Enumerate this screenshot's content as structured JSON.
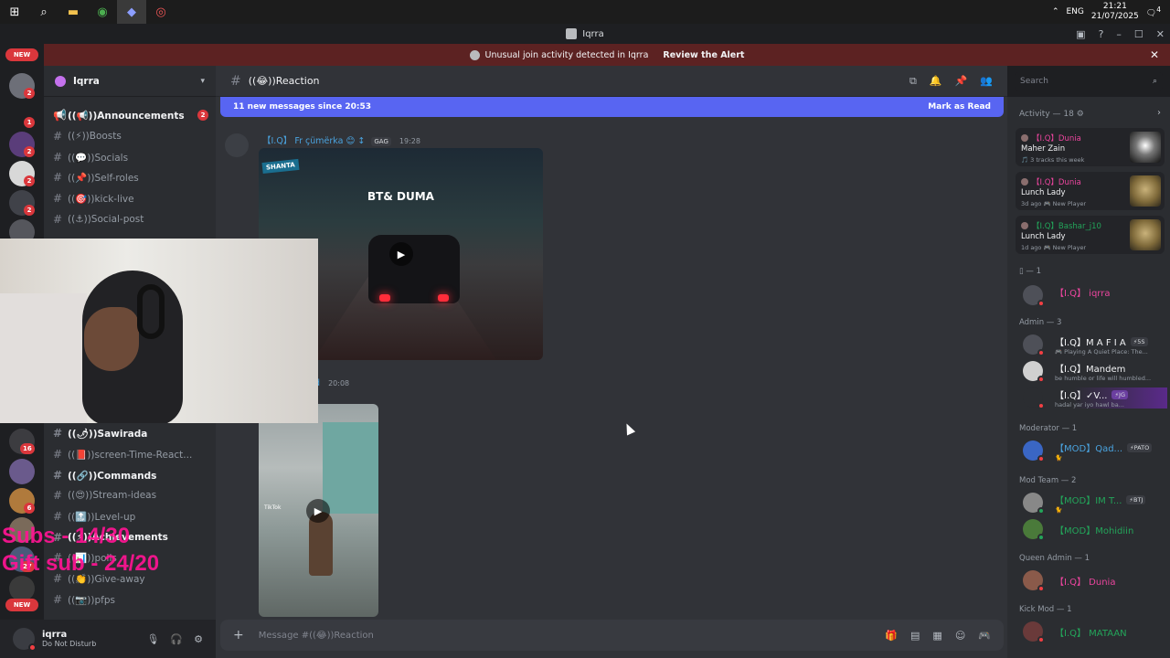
{
  "taskbar": {
    "icons": [
      "windows-icon",
      "search-icon",
      "folder-icon",
      "chrome-icon",
      "discord-icon",
      "recorder-icon"
    ],
    "lang": "ENG",
    "time": "21:21",
    "date": "21/07/2025",
    "notif_count": "4"
  },
  "window": {
    "title": "Iqrra"
  },
  "alert": {
    "text": "Unusual join activity detected in Iqrra",
    "action": "Review the Alert"
  },
  "rail": {
    "new_top": "NEW",
    "new_bottom": "NEW",
    "badges": [
      "2",
      "1",
      "2",
      "2",
      "2",
      "2",
      "16",
      "6",
      "27"
    ]
  },
  "sidebar": {
    "server_name": "Iqrra",
    "channels": [
      {
        "label": "((📢))Announcements",
        "bright": true,
        "badge": "2"
      },
      {
        "label": "((⚡))Boosts"
      },
      {
        "label": "((💬))Socials"
      },
      {
        "label": "((📌))Self-roles"
      },
      {
        "label": "((🎯))kick-live"
      },
      {
        "label": "((⚓))Social-post"
      },
      {
        "label": "((🌶))Sawirada",
        "bright": true
      },
      {
        "label": "((📕))screen-Time-React..."
      },
      {
        "label": "((🔗))Commands",
        "bright": true
      },
      {
        "label": "((😍))Stream-ideas"
      },
      {
        "label": "((🔝))Level-up"
      },
      {
        "label": "((⚡))Achievements",
        "bright": true
      },
      {
        "label": "((📊))polls"
      },
      {
        "label": "((👏))Give-away"
      },
      {
        "label": "((📷))pfps"
      }
    ]
  },
  "user": {
    "name": "iqrra",
    "status": "Do Not Disturb"
  },
  "chat": {
    "channel": "((😂))Reaction",
    "new_messages": "11 new messages since 20:53",
    "mark_read": "Mark as Read",
    "msg1": {
      "author": "【I.Q】 Fr çümërka 😊 ↕",
      "tag": "GAG",
      "time": "19:28",
      "video_caption": "BT& DUMA",
      "video_logo": "SHANTA"
    },
    "msg2": {
      "author_tail": "d",
      "time": "20:08",
      "tiktok": "TikTok"
    },
    "composer_placeholder": "Message #((😂))Reaction"
  },
  "search": {
    "placeholder": "Search"
  },
  "members": {
    "activity_header": "Activity — 18 ⚙",
    "activities": [
      {
        "who": "【I.Q】Dunia",
        "what": "Maher Zain",
        "sub": "🎵 3 tracks this week",
        "who_color": "#eb459e"
      },
      {
        "who": "【I.Q】Dunia",
        "what": "Lunch Lady",
        "sub": "3d ago  🎮 New Player",
        "who_color": "#eb459e"
      },
      {
        "who": "【I.Q】Bashar_j10",
        "what": "Lunch Lady",
        "sub": "1d ago  🎮 New Player",
        "who_color": "#23a55a"
      }
    ],
    "sections": [
      {
        "header": "▯ — 1",
        "members": [
          {
            "name": "【I.Q】 iqrra",
            "color": "#eb459e"
          }
        ]
      },
      {
        "header": "Admin — 3",
        "members": [
          {
            "name": "【I.Q】M A F I A",
            "color": "#f2f3f5",
            "badge": "⚡5S",
            "status": "🎮 Playing A Quiet Place: The..."
          },
          {
            "name": "【I.Q】Mandem",
            "color": "#f2f3f5",
            "status": "be humble or life will humbled..."
          },
          {
            "name": "【I.Q】✓V...",
            "color": "#f2f3f5",
            "badge": "⚡JG",
            "status": "hadal yar iyo hawl ba..."
          }
        ]
      },
      {
        "header": "Moderator — 1",
        "members": [
          {
            "name": "【MOD】Qad...",
            "color": "#4aa3df",
            "badge": "⚡PATO",
            "status": "🐈"
          }
        ]
      },
      {
        "header": "Mod Team — 2",
        "members": [
          {
            "name": "【MOD】IM T...",
            "color": "#23a55a",
            "badge": "⚡BTJ",
            "status": "🐈"
          },
          {
            "name": "【MOD】Mohidiin",
            "color": "#23a55a"
          }
        ]
      },
      {
        "header": "Queen Admin — 1",
        "members": [
          {
            "name": "【I.Q】 Dunia",
            "color": "#eb459e"
          }
        ]
      },
      {
        "header": "Kick Mod — 1",
        "members": [
          {
            "name": "【I.Q】 MATAAN",
            "color": "#23a55a"
          }
        ]
      }
    ]
  },
  "overlay": {
    "line1": "Subs - 14/30",
    "line2": "Gift sub - 24/20"
  }
}
